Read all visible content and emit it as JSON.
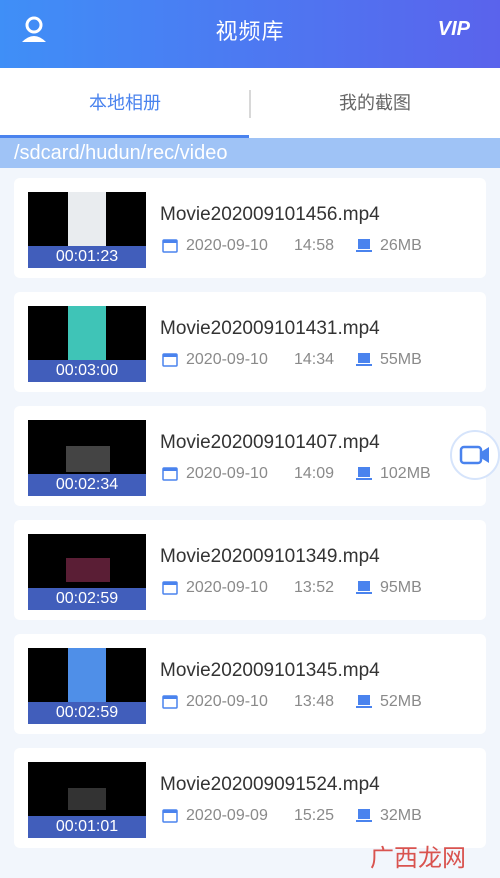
{
  "header": {
    "title": "视频库",
    "vip_label": "VIP"
  },
  "tabs": [
    {
      "label": "本地相册",
      "active": true
    },
    {
      "label": "我的截图",
      "active": false
    }
  ],
  "path": "/sdcard/hudun/rec/video",
  "videos": [
    {
      "name": "Movie202009101456.mp4",
      "date": "2020-09-10",
      "time": "14:58",
      "size": "26MB",
      "duration": "00:01:23",
      "thumb_color": "#e9ecef"
    },
    {
      "name": "Movie202009101431.mp4",
      "date": "2020-09-10",
      "time": "14:34",
      "size": "55MB",
      "duration": "00:03:00",
      "thumb_color": "#3fc4b7"
    },
    {
      "name": "Movie202009101407.mp4",
      "date": "2020-09-10",
      "time": "14:09",
      "size": "102MB",
      "duration": "00:02:34",
      "thumb_color": "#222"
    },
    {
      "name": "Movie202009101349.mp4",
      "date": "2020-09-10",
      "time": "13:52",
      "size": "95MB",
      "duration": "00:02:59",
      "thumb_color": "#3a1a2a"
    },
    {
      "name": "Movie202009101345.mp4",
      "date": "2020-09-10",
      "time": "13:48",
      "size": "52MB",
      "duration": "00:02:59",
      "thumb_color": "#4f8fe8"
    },
    {
      "name": "Movie202009091524.mp4",
      "date": "2020-09-09",
      "time": "15:25",
      "size": "32MB",
      "duration": "00:01:01",
      "thumb_color": "#1b1b1b"
    }
  ],
  "watermark": "广西龙网",
  "colors": {
    "accent": "#4a83ee",
    "header_start": "#3f8ff7",
    "header_end": "#5a63ec",
    "path_bar": "#9fc3f6"
  },
  "icons": {
    "avatar": "user-icon",
    "calendar": "calendar-icon",
    "storage": "storage-icon",
    "record": "video-camera-icon"
  }
}
